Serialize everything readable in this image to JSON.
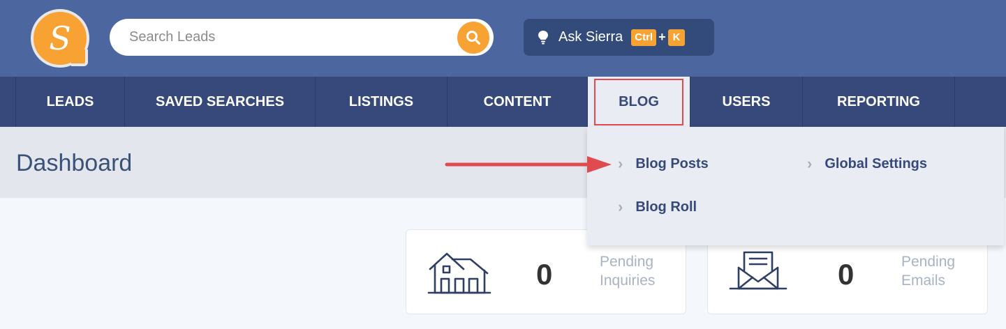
{
  "header": {
    "logo_letter": "S",
    "search": {
      "placeholder": "Search Leads"
    },
    "ask_sierra": {
      "label": "Ask Sierra",
      "key1": "Ctrl",
      "plus": "+",
      "key2": "K"
    }
  },
  "nav": {
    "items": [
      {
        "label": "LEADS"
      },
      {
        "label": "SAVED SEARCHES"
      },
      {
        "label": "LISTINGS"
      },
      {
        "label": "CONTENT"
      },
      {
        "label": "BLOG",
        "active": true
      },
      {
        "label": "USERS"
      },
      {
        "label": "REPORTING"
      }
    ]
  },
  "dropdown": {
    "items": [
      {
        "label": "Blog Posts"
      },
      {
        "label": "Global Settings"
      },
      {
        "label": "Blog Roll"
      }
    ]
  },
  "page": {
    "title": "Dashboard"
  },
  "cards": [
    {
      "count": "0",
      "label_line1": "Pending",
      "label_line2": "Inquiries",
      "icon": "house-icon"
    },
    {
      "count": "0",
      "label_line1": "Pending",
      "label_line2": "Emails",
      "icon": "email-icon"
    }
  ],
  "colors": {
    "topbar": "#4c67a0",
    "nav": "#36497a",
    "accent": "#f7a233",
    "annotation": "#e04b50"
  }
}
